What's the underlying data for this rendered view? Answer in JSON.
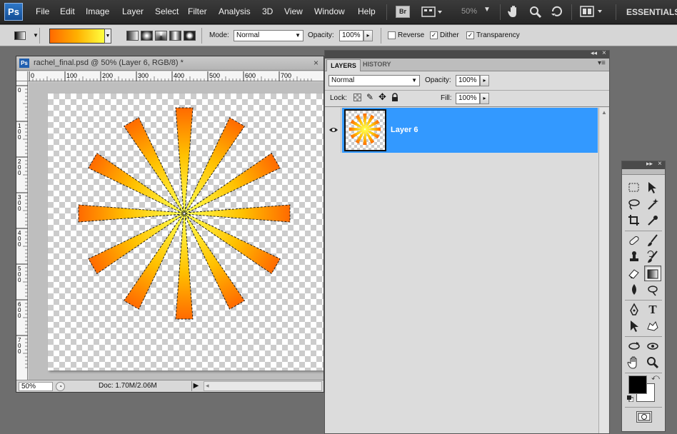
{
  "menubar": {
    "logo": "Ps",
    "items": [
      "File",
      "Edit",
      "Image",
      "Layer",
      "Select",
      "Filter",
      "Analysis",
      "3D",
      "View",
      "Window",
      "Help"
    ],
    "bridge_label": "Br",
    "zoom": "50%",
    "workspace": "ESSENTIALS"
  },
  "options": {
    "mode_label": "Mode:",
    "mode_value": "Normal",
    "opacity_label": "Opacity:",
    "opacity_value": "100%",
    "reverse_label": "Reverse",
    "reverse_checked": false,
    "dither_label": "Dither",
    "dither_checked": true,
    "transparency_label": "Transparency",
    "transparency_checked": true,
    "gradient_colors": [
      "#ff6a00",
      "#ffb000",
      "#ffff40"
    ]
  },
  "document": {
    "title": "rachel_final.psd @ 50% (Layer 6, RGB/8) *",
    "logo": "Ps",
    "ruler_h": [
      "0",
      "100",
      "200",
      "300",
      "400",
      "500",
      "600",
      "700"
    ],
    "ruler_v": [
      "0",
      "1 0 0",
      "2 0 0",
      "3 0 0",
      "4 0 0",
      "5 0 0",
      "6 0 0",
      "7 0 0"
    ],
    "status_zoom": "50%",
    "status_doc": "Doc: 1.70M/2.06M"
  },
  "layers_panel": {
    "tabs": [
      "LAYERS",
      "HISTORY"
    ],
    "blend_mode": "Normal",
    "opacity_label": "Opacity:",
    "opacity_value": "100%",
    "lock_label": "Lock:",
    "fill_label": "Fill:",
    "fill_value": "100%",
    "layers": [
      {
        "name": "Layer 6",
        "visible": true,
        "selected": true
      }
    ],
    "selected_color": "#3399ff"
  },
  "toolbox": {
    "tools": [
      "marquee",
      "move",
      "lasso",
      "magic-wand",
      "crop",
      "eyedropper",
      "healing",
      "brush",
      "stamp",
      "history-brush",
      "eraser",
      "gradient",
      "blur",
      "dodge",
      "pen",
      "type",
      "path-select",
      "shape",
      "3d-rotate",
      "3d-orbit",
      "hand",
      "zoom"
    ],
    "type_label": "T",
    "foreground_color": "#000000",
    "background_color": "#ffffff"
  }
}
